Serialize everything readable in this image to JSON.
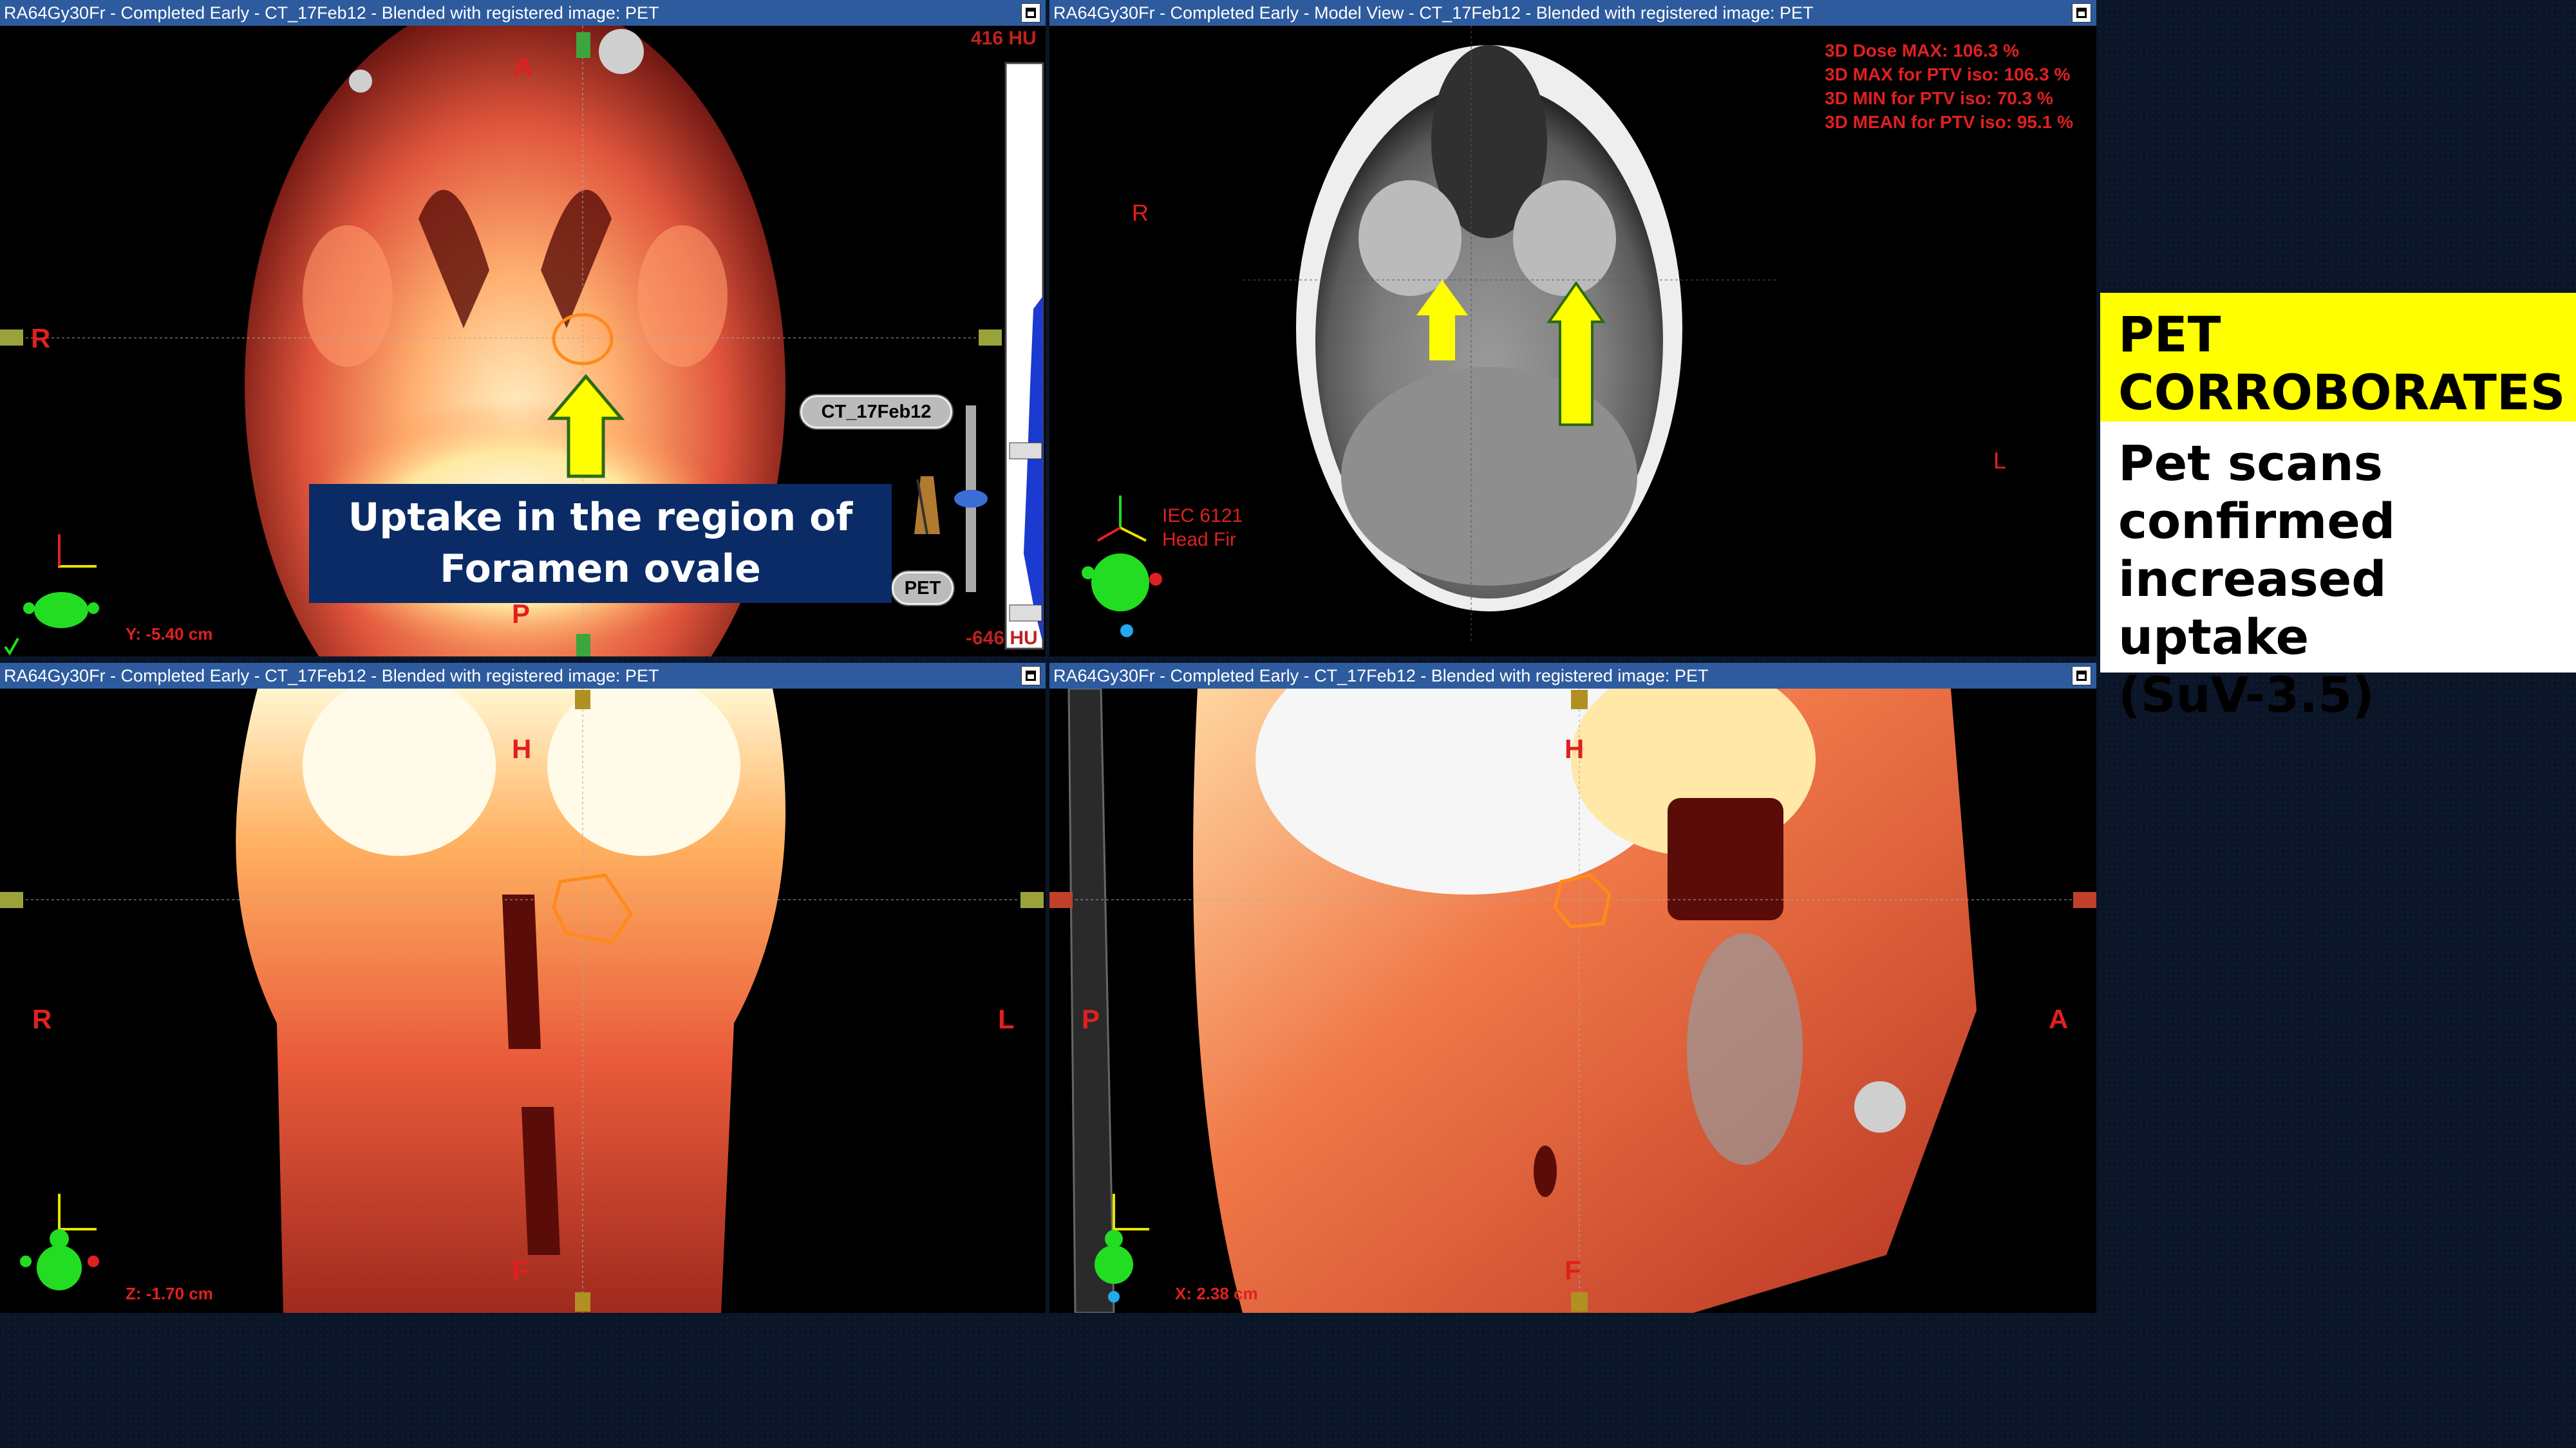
{
  "panes": {
    "axial": {
      "title": "RA64Gy30Fr  -  Completed Early - CT_17Feb12 -   Blended with registered image: PET",
      "orientation": {
        "top": "A",
        "left": "R",
        "bottom": "P"
      },
      "coordinate": "Y: -5.40 cm",
      "window_top": "416 HU",
      "window_bottom": "-646 HU",
      "blend_primary": "CT_17Feb12",
      "blend_secondary": "PET"
    },
    "model": {
      "title": "RA64Gy30Fr  -  Completed Early  -  Model View  -  CT_17Feb12  -   Blended with registered image: PET",
      "orientation": {
        "left": "R",
        "right": "L"
      },
      "dose_stats": [
        "3D Dose MAX: 106.3 %",
        "3D MAX for PTV iso: 106.3 %",
        "3D MIN for PTV iso: 70.3 %",
        "3D MEAN for PTV iso: 95.1 %"
      ],
      "coord_system": "IEC 6121",
      "coord_system_2": "Head Fir"
    },
    "coronal": {
      "title": "RA64Gy30Fr  -  Completed Early - CT_17Feb12 -   Blended with registered image: PET",
      "orientation": {
        "top": "H",
        "left": "R",
        "right": "L",
        "bottom": "F"
      },
      "coordinate": "Z: -1.70 cm"
    },
    "sagittal": {
      "title": "RA64Gy30Fr  -  Completed Early - CT_17Feb12 -   Blended with registered image: PET",
      "orientation": {
        "top": "H",
        "left": "P",
        "right": "A",
        "bottom": "F"
      },
      "coordinate": "X: 2.38 cm"
    }
  },
  "callout": {
    "line1": "Uptake in the region of",
    "line2": "Foramen ovale"
  },
  "side_panel": {
    "heading_line1": "PET",
    "heading_line2": "CORROBORATES",
    "body_line1": "Pet scans",
    "body_line2": "confirmed",
    "body_line3": "increased uptake",
    "body_line4": "(SuV-3.5)"
  },
  "colors": {
    "titlebar": "#2d5b9e",
    "orientation_label": "#e02020",
    "arrow": "#ffff00",
    "roi_contour": "#ff8a1a",
    "heading_bg": "#ffff00",
    "callout_bg": "#0a2b66"
  },
  "icons": [
    "restore-icon",
    "patient-figure-icon",
    "axes-icon",
    "metronome-icon",
    "arrow-up-icon"
  ]
}
